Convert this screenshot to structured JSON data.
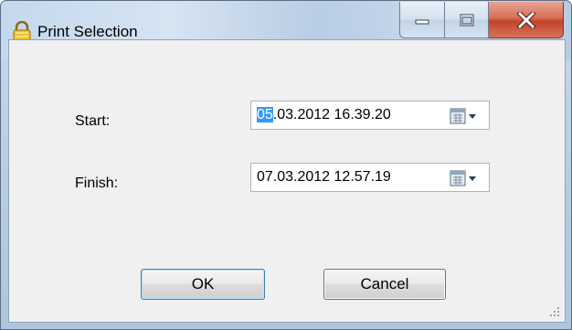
{
  "window": {
    "title": "Print Selection"
  },
  "titlebar": {
    "app_icon": "lock-icon",
    "minimize_icon": "minimize-icon",
    "maximize_icon": "maximize-icon",
    "close_icon": "close-icon"
  },
  "form": {
    "start_label": "Start:",
    "start_value_selected": "05",
    "start_value_rest": ".03.2012 16.39.20",
    "finish_label": "Finish:",
    "finish_value": "07.03.2012 12.57.19",
    "calendar_icon": "calendar-dropdown-icon"
  },
  "buttons": {
    "ok_label": "OK",
    "cancel_label": "Cancel"
  },
  "colors": {
    "selection": "#3399ff",
    "close_button": "#c2432a",
    "client_bg": "#f0f0f0"
  }
}
